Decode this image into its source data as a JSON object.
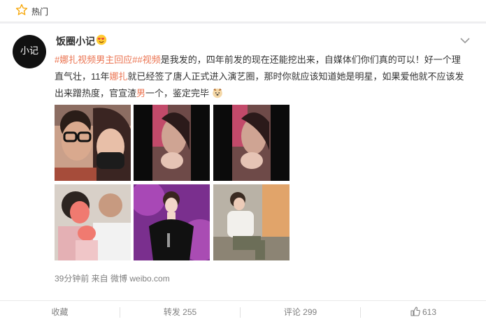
{
  "topbar": {
    "label": "热门",
    "icon": "star-icon"
  },
  "post": {
    "avatar_text": "小记",
    "username": "饭圈小记",
    "text": {
      "tag1": "#娜扎视频男主回应#",
      "tag2": "#视频",
      "seg1": "是我发的，四年前发的现在还能挖出来，自媒体们你们真的可以！好一个理直气壮，11年",
      "kw1": "娜扎",
      "seg2": "就已经签了唐人正式进入演艺圈，那时你就应该知道她是明星，如果爱他就不应该发出来蹭热度，官宣渣",
      "kw2": "男",
      "seg3": "一个，鉴定完毕"
    },
    "meta": "39分钟前 来自 微博 weibo.com"
  },
  "actions": {
    "favorite": "收藏",
    "repost": "转发 255",
    "comment": "评论 299",
    "like": "613"
  },
  "colors": {
    "accent": "#eb7350",
    "meta_gray": "#808080"
  }
}
